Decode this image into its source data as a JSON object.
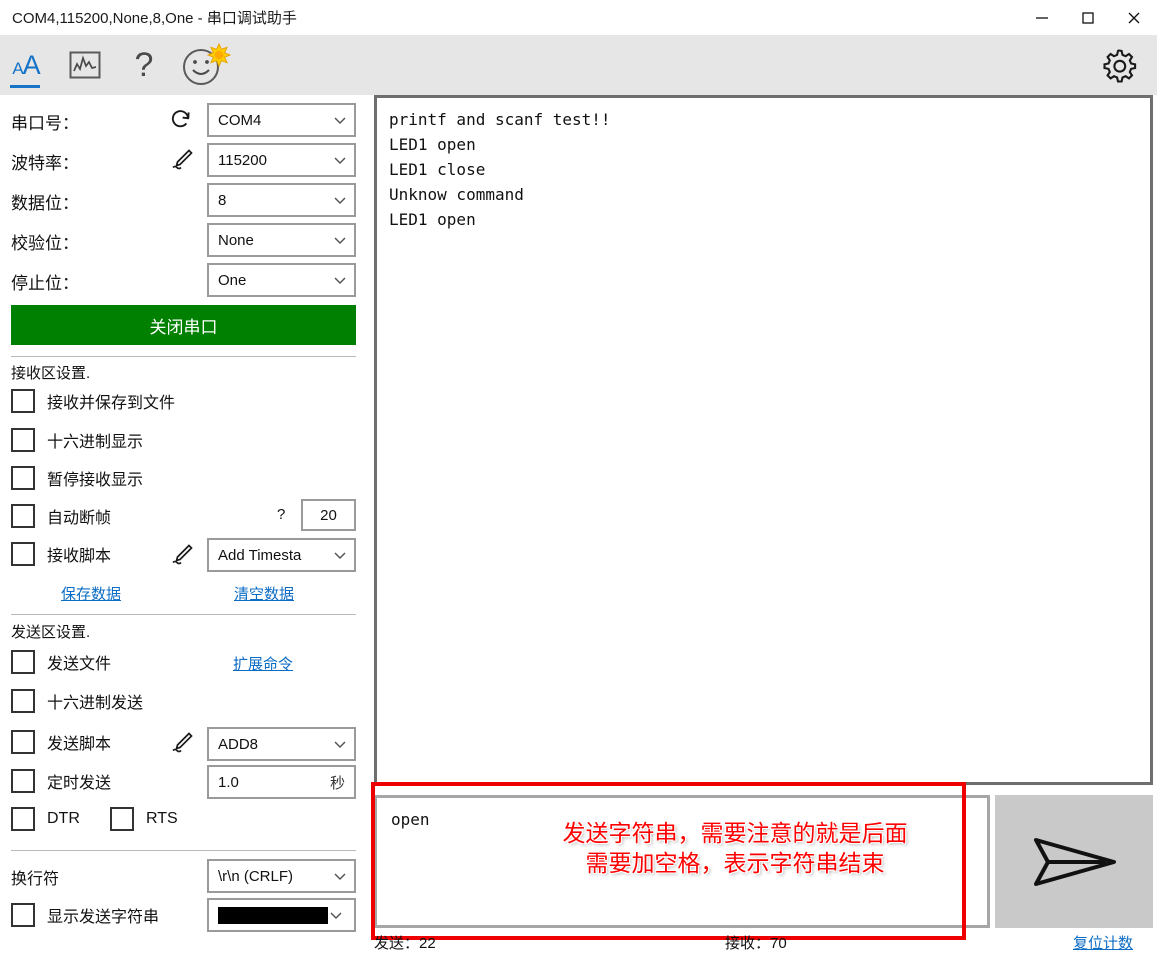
{
  "window": {
    "title": "COM4,115200,None,8,One - 串口调试助手",
    "minimize_label": "minimize",
    "maximize_label": "maximize",
    "close_label": "close"
  },
  "toolbar": {
    "font_icon_small": "A",
    "font_icon_large": "A",
    "help_icon": "?",
    "items": [
      {
        "name": "font-size-icon",
        "label": "AA"
      },
      {
        "name": "waveform-icon",
        "label": "波形"
      },
      {
        "name": "help-icon",
        "label": "?"
      },
      {
        "name": "smiley-icon",
        "label": "关于"
      },
      {
        "name": "gear-icon",
        "label": "设置"
      }
    ]
  },
  "serial": {
    "port_label": "串口号：",
    "port_value": "COM4",
    "baud_label": "波特率：",
    "baud_value": "115200",
    "databits_label": "数据位：",
    "databits_value": "8",
    "parity_label": "校验位：",
    "parity_value": "None",
    "stopbits_label": "停止位：",
    "stopbits_value": "One",
    "toggle_button": "关闭串口"
  },
  "receive_settings": {
    "title": "接收区设置.",
    "checkboxes": [
      {
        "label": "接收并保存到文件",
        "checked": false
      },
      {
        "label": "十六进制显示",
        "checked": false
      },
      {
        "label": "暂停接收显示",
        "checked": false
      },
      {
        "label": "自动断帧",
        "checked": false
      },
      {
        "label": "接收脚本",
        "checked": false
      }
    ],
    "auto_frame_help": "?",
    "auto_frame_value": "20",
    "script_value": "Add Timesta",
    "save_link": "保存数据",
    "clear_link": "清空数据"
  },
  "send_settings": {
    "title": "发送区设置.",
    "checkboxes": [
      {
        "label": "发送文件",
        "checked": false
      },
      {
        "label": "十六进制发送",
        "checked": false
      },
      {
        "label": "发送脚本",
        "checked": false
      },
      {
        "label": "定时发送",
        "checked": false
      },
      {
        "label": "DTR",
        "checked": false
      },
      {
        "label": "RTS",
        "checked": false
      }
    ],
    "extend_link": "扩展命令",
    "script_value": "ADD8",
    "interval_value": "1.0",
    "interval_unit": "秒"
  },
  "line_ending": {
    "label": "换行符",
    "value": "\\r\\n (CRLF)",
    "show_send_label": "显示发送字符串",
    "color_value": "#000000"
  },
  "receive_area": {
    "text": "printf and scanf test!!\nLED1 open\nLED1 close\nUnknow command\nLED1 open"
  },
  "send_area": {
    "text": "open",
    "send_icon": "paper-plane-icon"
  },
  "annotation": {
    "text": "发送字符串，需要注意的就是后面\n需要加空格，表示字符串结束",
    "color": "#ff0000"
  },
  "status": {
    "sent": "发送：22",
    "received": "接收：70",
    "reset_link": "复位计数"
  },
  "colors": {
    "accent_blue": "#1673c8",
    "link_blue": "#0d6cc4",
    "open_green": "#008000",
    "annotation_red": "#ff0000",
    "toolbar_bg": "#e6e6e6"
  }
}
